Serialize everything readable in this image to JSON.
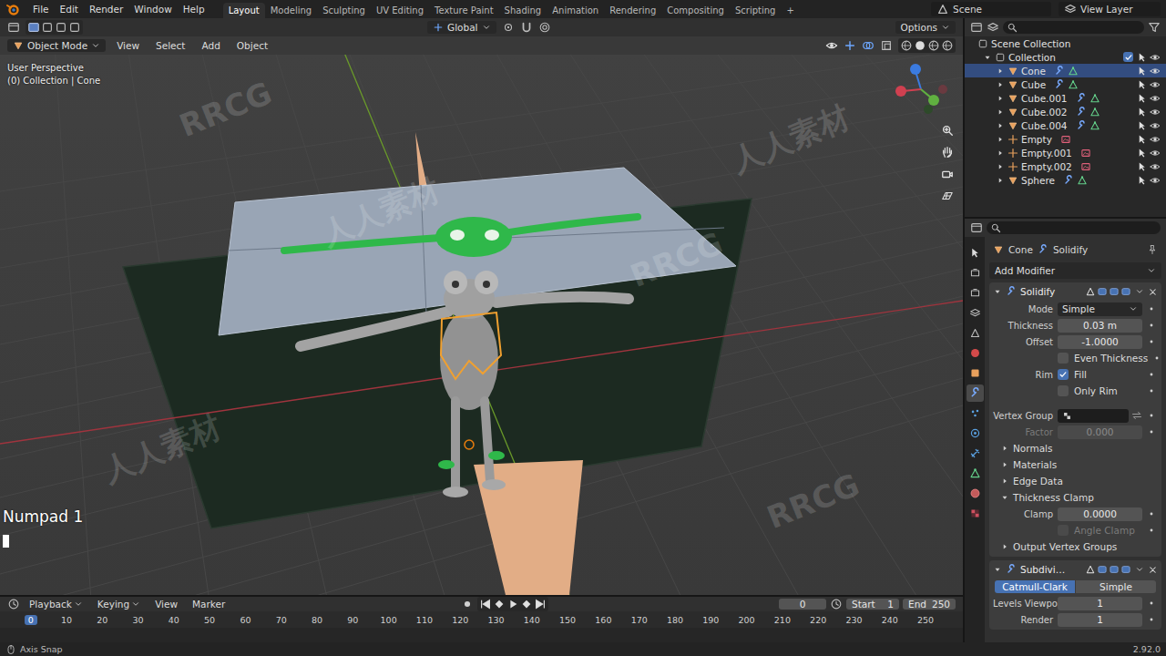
{
  "menubar": {
    "menus": [
      "File",
      "Edit",
      "Render",
      "Window",
      "Help"
    ],
    "workspaces": [
      {
        "label": "Layout",
        "selected": true
      },
      {
        "label": "Modeling",
        "selected": false
      },
      {
        "label": "Sculpting",
        "selected": false
      },
      {
        "label": "UV Editing",
        "selected": false
      },
      {
        "label": "Texture Paint",
        "selected": false
      },
      {
        "label": "Shading",
        "selected": false
      },
      {
        "label": "Animation",
        "selected": false
      },
      {
        "label": "Rendering",
        "selected": false
      },
      {
        "label": "Compositing",
        "selected": false
      },
      {
        "label": "Scripting",
        "selected": false
      }
    ],
    "add_workspace": "+",
    "scene": "Scene",
    "view_layer": "View Layer"
  },
  "viewport": {
    "orientation": "Global",
    "options": "Options",
    "mode": "Object Mode",
    "menus": [
      "View",
      "Select",
      "Add",
      "Object"
    ],
    "perspective": "User Perspective",
    "context": "(0) Collection | Cone",
    "last_key": "Numpad 1"
  },
  "outliner": {
    "root": "Scene Collection",
    "collection": "Collection",
    "collection_checked": true,
    "items": [
      {
        "name": "Cone",
        "kind": "mesh",
        "selected": true
      },
      {
        "name": "Cube",
        "kind": "mesh",
        "selected": false
      },
      {
        "name": "Cube.001",
        "kind": "mesh",
        "selected": false
      },
      {
        "name": "Cube.002",
        "kind": "mesh",
        "selected": false
      },
      {
        "name": "Cube.004",
        "kind": "mesh",
        "selected": false
      },
      {
        "name": "Empty",
        "kind": "empty",
        "selected": false
      },
      {
        "name": "Empty.001",
        "kind": "empty",
        "selected": false
      },
      {
        "name": "Empty.002",
        "kind": "empty",
        "selected": false
      },
      {
        "name": "Sphere",
        "kind": "mesh",
        "selected": false
      }
    ]
  },
  "properties": {
    "editor_tabs": [
      {
        "selected": false
      },
      {
        "selected": false
      },
      {
        "selected": false
      },
      {
        "selected": false
      },
      {
        "selected": false
      },
      {
        "selected": false
      },
      {
        "selected": false
      },
      {
        "selected": true
      },
      {
        "selected": false
      },
      {
        "selected": false
      },
      {
        "selected": false
      },
      {
        "selected": false
      },
      {
        "selected": false
      },
      {
        "selected": false
      }
    ],
    "object": "Cone",
    "modifier": "Solidify",
    "add_modifier": "Add Modifier",
    "modifiers": [
      {
        "name": "Solidify",
        "expanded": true,
        "rows": [
          {
            "kind": "dropdown",
            "label": "Mode",
            "value": "Simple",
            "disabled": false
          },
          {
            "kind": "number",
            "label": "Thickness",
            "value": "0.03 m",
            "disabled": false
          },
          {
            "kind": "number",
            "label": "Offset",
            "value": "-1.0000",
            "disabled": false
          },
          {
            "kind": "checkbox",
            "text": "Even Thickness",
            "checked": false,
            "disabled": false
          },
          {
            "kind": "checkbox",
            "label": "Rim",
            "text": "Fill",
            "checked": true,
            "disabled": false
          },
          {
            "kind": "checkbox",
            "text": "Only Rim",
            "checked": false,
            "disabled": false
          },
          {
            "kind": "group",
            "label": "Vertex Group",
            "disabled": false
          },
          {
            "kind": "number",
            "label": "Factor",
            "value": "0.000",
            "disabled": true
          },
          {
            "kind": "subpanel",
            "text": "Normals",
            "expanded": false,
            "disabled": false
          },
          {
            "kind": "subpanel",
            "text": "Materials",
            "expanded": false,
            "disabled": false
          },
          {
            "kind": "subpanel",
            "text": "Edge Data",
            "expanded": false,
            "disabled": false
          },
          {
            "kind": "subpanel",
            "text": "Thickness Clamp",
            "expanded": true,
            "disabled": false
          },
          {
            "kind": "number",
            "label": "Clamp",
            "value": "0.0000",
            "disabled": false
          },
          {
            "kind": "checkbox",
            "text": "Angle Clamp",
            "checked": false,
            "disabled": true
          },
          {
            "kind": "subpanel",
            "text": "Output Vertex Groups",
            "expanded": false,
            "disabled": false
          }
        ]
      },
      {
        "name": "Subdivi…",
        "expanded": true,
        "modes": [
          {
            "label": "Catmull-Clark",
            "selected": true
          },
          {
            "label": "Simple",
            "selected": false
          }
        ],
        "rows": [
          {
            "kind": "number",
            "label": "Levels Viewport",
            "value": "1",
            "disabled": false
          },
          {
            "kind": "number",
            "label": "Render",
            "value": "1",
            "disabled": false
          }
        ]
      }
    ]
  },
  "timeline": {
    "menus": [
      {
        "label": "Playback",
        "dropdown": true
      },
      {
        "label": "Keying",
        "dropdown": true
      },
      {
        "label": "View",
        "dropdown": false
      },
      {
        "label": "Marker",
        "dropdown": false
      }
    ],
    "current_frame": "0",
    "start_label": "Start",
    "start": "1",
    "end_label": "End",
    "end": "250",
    "ticks": [
      {
        "label": "0",
        "selected": true
      },
      {
        "label": "10",
        "selected": false
      },
      {
        "label": "20",
        "selected": false
      },
      {
        "label": "30",
        "selected": false
      },
      {
        "label": "40",
        "selected": false
      },
      {
        "label": "50",
        "selected": false
      },
      {
        "label": "60",
        "selected": false
      },
      {
        "label": "70",
        "selected": false
      },
      {
        "label": "80",
        "selected": false
      },
      {
        "label": "90",
        "selected": false
      },
      {
        "label": "100",
        "selected": false
      },
      {
        "label": "110",
        "selected": false
      },
      {
        "label": "120",
        "selected": false
      },
      {
        "label": "130",
        "selected": false
      },
      {
        "label": "140",
        "selected": false
      },
      {
        "label": "150",
        "selected": false
      },
      {
        "label": "160",
        "selected": false
      },
      {
        "label": "170",
        "selected": false
      },
      {
        "label": "180",
        "selected": false
      },
      {
        "label": "190",
        "selected": false
      },
      {
        "label": "200",
        "selected": false
      },
      {
        "label": "210",
        "selected": false
      },
      {
        "label": "220",
        "selected": false
      },
      {
        "label": "230",
        "selected": false
      },
      {
        "label": "240",
        "selected": false
      },
      {
        "label": "250",
        "selected": false
      }
    ]
  },
  "status_bar": {
    "hint": "Axis Snap",
    "version": "2.92.0"
  },
  "watermarks": [
    "RRCG",
    "人人素材",
    "RRCG",
    "人人素材",
    "RRCG",
    "人人素材"
  ]
}
